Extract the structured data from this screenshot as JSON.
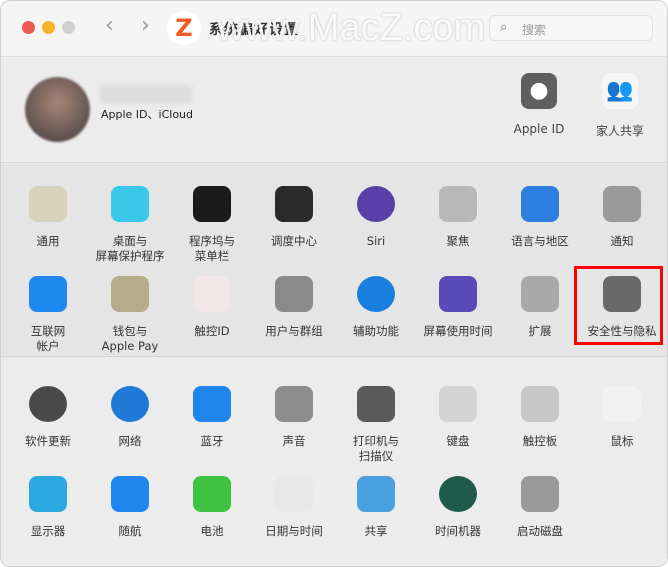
{
  "window": {
    "title": "系统偏好设置",
    "watermark": "www.MacZ.com",
    "logo": "Z",
    "search_placeholder": "搜索"
  },
  "profile": {
    "subtitle": "Apple ID、iCloud",
    "shortcuts": [
      {
        "label": "Apple ID",
        "icon": "apple-icon",
        "color": "#5f5f5f"
      },
      {
        "label": "家人共享",
        "icon": "family-icon",
        "color": "#4aa3f0"
      }
    ]
  },
  "section1": [
    {
      "label": "通用",
      "icon": "general-icon",
      "color": "#d8d2b8"
    },
    {
      "label": "桌面与\n屏幕保护程序",
      "icon": "desktop-icon",
      "color": "#3cc8ea"
    },
    {
      "label": "程序坞与\n菜单栏",
      "icon": "dock-icon",
      "color": "#1b1b1b"
    },
    {
      "label": "调度中心",
      "icon": "mission-control-icon",
      "color": "#2a2a2a"
    },
    {
      "label": "Siri",
      "icon": "siri-icon",
      "color": "#5b3fa8"
    },
    {
      "label": "聚焦",
      "icon": "spotlight-icon",
      "color": "#b8b8b8"
    },
    {
      "label": "语言与地区",
      "icon": "language-flag-icon",
      "color": "#2f7fe0"
    },
    {
      "label": "通知",
      "icon": "notification-bell-icon",
      "color": "#9a9a9a"
    },
    {
      "label": "互联网\n帐户",
      "icon": "internet-accounts-icon",
      "color": "#1e88f0"
    },
    {
      "label": "钱包与\nApple Pay",
      "icon": "wallet-icon",
      "color": "#b9ab8c"
    },
    {
      "label": "触控ID",
      "icon": "fingerprint-icon",
      "color": "#f2e6e8"
    },
    {
      "label": "用户与群组",
      "icon": "users-icon",
      "color": "#8a8a8a"
    },
    {
      "label": "辅助功能",
      "icon": "accessibility-icon",
      "color": "#1a7de0"
    },
    {
      "label": "屏幕使用时间",
      "icon": "hourglass-icon",
      "color": "#5a4bb8"
    },
    {
      "label": "扩展",
      "icon": "extensions-icon",
      "color": "#a9a9a9"
    },
    {
      "label": "安全性与隐私",
      "icon": "security-house-icon",
      "color": "#6a6a6a"
    }
  ],
  "section2": [
    {
      "label": "软件更新",
      "icon": "software-update-icon",
      "color": "#4a4a4a"
    },
    {
      "label": "网络",
      "icon": "network-globe-icon",
      "color": "#1f7ad8"
    },
    {
      "label": "蓝牙",
      "icon": "bluetooth-icon",
      "color": "#1f86f0"
    },
    {
      "label": "声音",
      "icon": "speaker-icon",
      "color": "#8e8e8e"
    },
    {
      "label": "打印机与\n扫描仪",
      "icon": "printer-icon",
      "color": "#5a5a5a"
    },
    {
      "label": "键盘",
      "icon": "keyboard-icon",
      "color": "#d4d4d4"
    },
    {
      "label": "触控板",
      "icon": "trackpad-icon",
      "color": "#c8c8c8"
    },
    {
      "label": "鼠标",
      "icon": "mouse-icon",
      "color": "#f2f2f2"
    },
    {
      "label": "显示器",
      "icon": "display-icon",
      "color": "#29a9e0"
    },
    {
      "label": "随航",
      "icon": "sidecar-icon",
      "color": "#1f86f0"
    },
    {
      "label": "电池",
      "icon": "battery-icon",
      "color": "#3fc23f"
    },
    {
      "label": "日期与时间",
      "icon": "clock-icon",
      "color": "#e8e8e8"
    },
    {
      "label": "共享",
      "icon": "sharing-folder-icon",
      "color": "#4aa0e0"
    },
    {
      "label": "时间机器",
      "icon": "time-machine-icon",
      "color": "#1f5a4a"
    },
    {
      "label": "启动磁盘",
      "icon": "startup-disk-icon",
      "color": "#9a9a9a"
    }
  ],
  "highlight_color": "#ff0000"
}
